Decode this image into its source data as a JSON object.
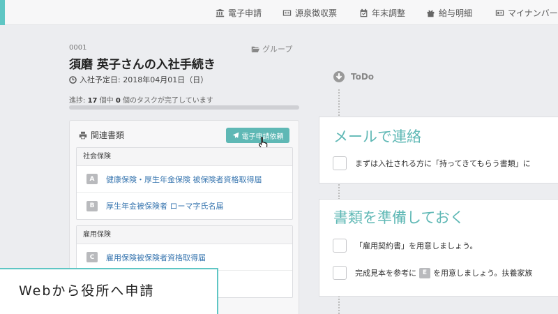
{
  "nav": {
    "items": [
      {
        "label": "電子申請",
        "icon": "building-icon"
      },
      {
        "label": "源泉徴収票",
        "icon": "document-icon"
      },
      {
        "label": "年末調整",
        "icon": "calendar-check-icon"
      },
      {
        "label": "給与明細",
        "icon": "gift-icon"
      },
      {
        "label": "マイナンバー",
        "icon": "id-card-icon"
      }
    ],
    "accent_color": "#5fc6c4"
  },
  "employee": {
    "id": "0001",
    "group_label": "グループ",
    "title": "須磨 英子さんの入社手続き",
    "start_date_label": "入社予定日: 2018年04月01日（日）"
  },
  "progress": {
    "prefix": "進捗: ",
    "total": "17",
    "mid": " 個中 ",
    "done": "0",
    "suffix": " 個のタスクが完了しています",
    "fraction": 0
  },
  "docs": {
    "title": "関連書類",
    "e_request_button": "電子申請依頼",
    "sections": [
      {
        "name": "社会保険",
        "rows": [
          {
            "badge": "A",
            "label": "健康保険・厚生年金保険 被保険者資格取得届"
          },
          {
            "badge": "B",
            "label": "厚生年金被保険者 ローマ字氏名届"
          }
        ]
      },
      {
        "name": "雇用保険",
        "rows": [
          {
            "badge": "C",
            "label": "雇用保険被保険者資格取得届"
          }
        ]
      }
    ]
  },
  "todo": {
    "label": "ToDo",
    "cards": [
      {
        "title": "メールで連絡",
        "items": [
          "まずは入社される方に「持ってきてもらう書類」に"
        ]
      },
      {
        "title": "書類を準備しておく",
        "items": [
          "「雇用契約書」を用意しましょう。"
        ],
        "item2_before": "完成見本を参考に",
        "item2_badge": "E",
        "item2_after": "を用意しましょう。扶養家族"
      }
    ],
    "accent_color": "#5fb8b5"
  },
  "caption": {
    "text": "Webから役所へ申請"
  }
}
